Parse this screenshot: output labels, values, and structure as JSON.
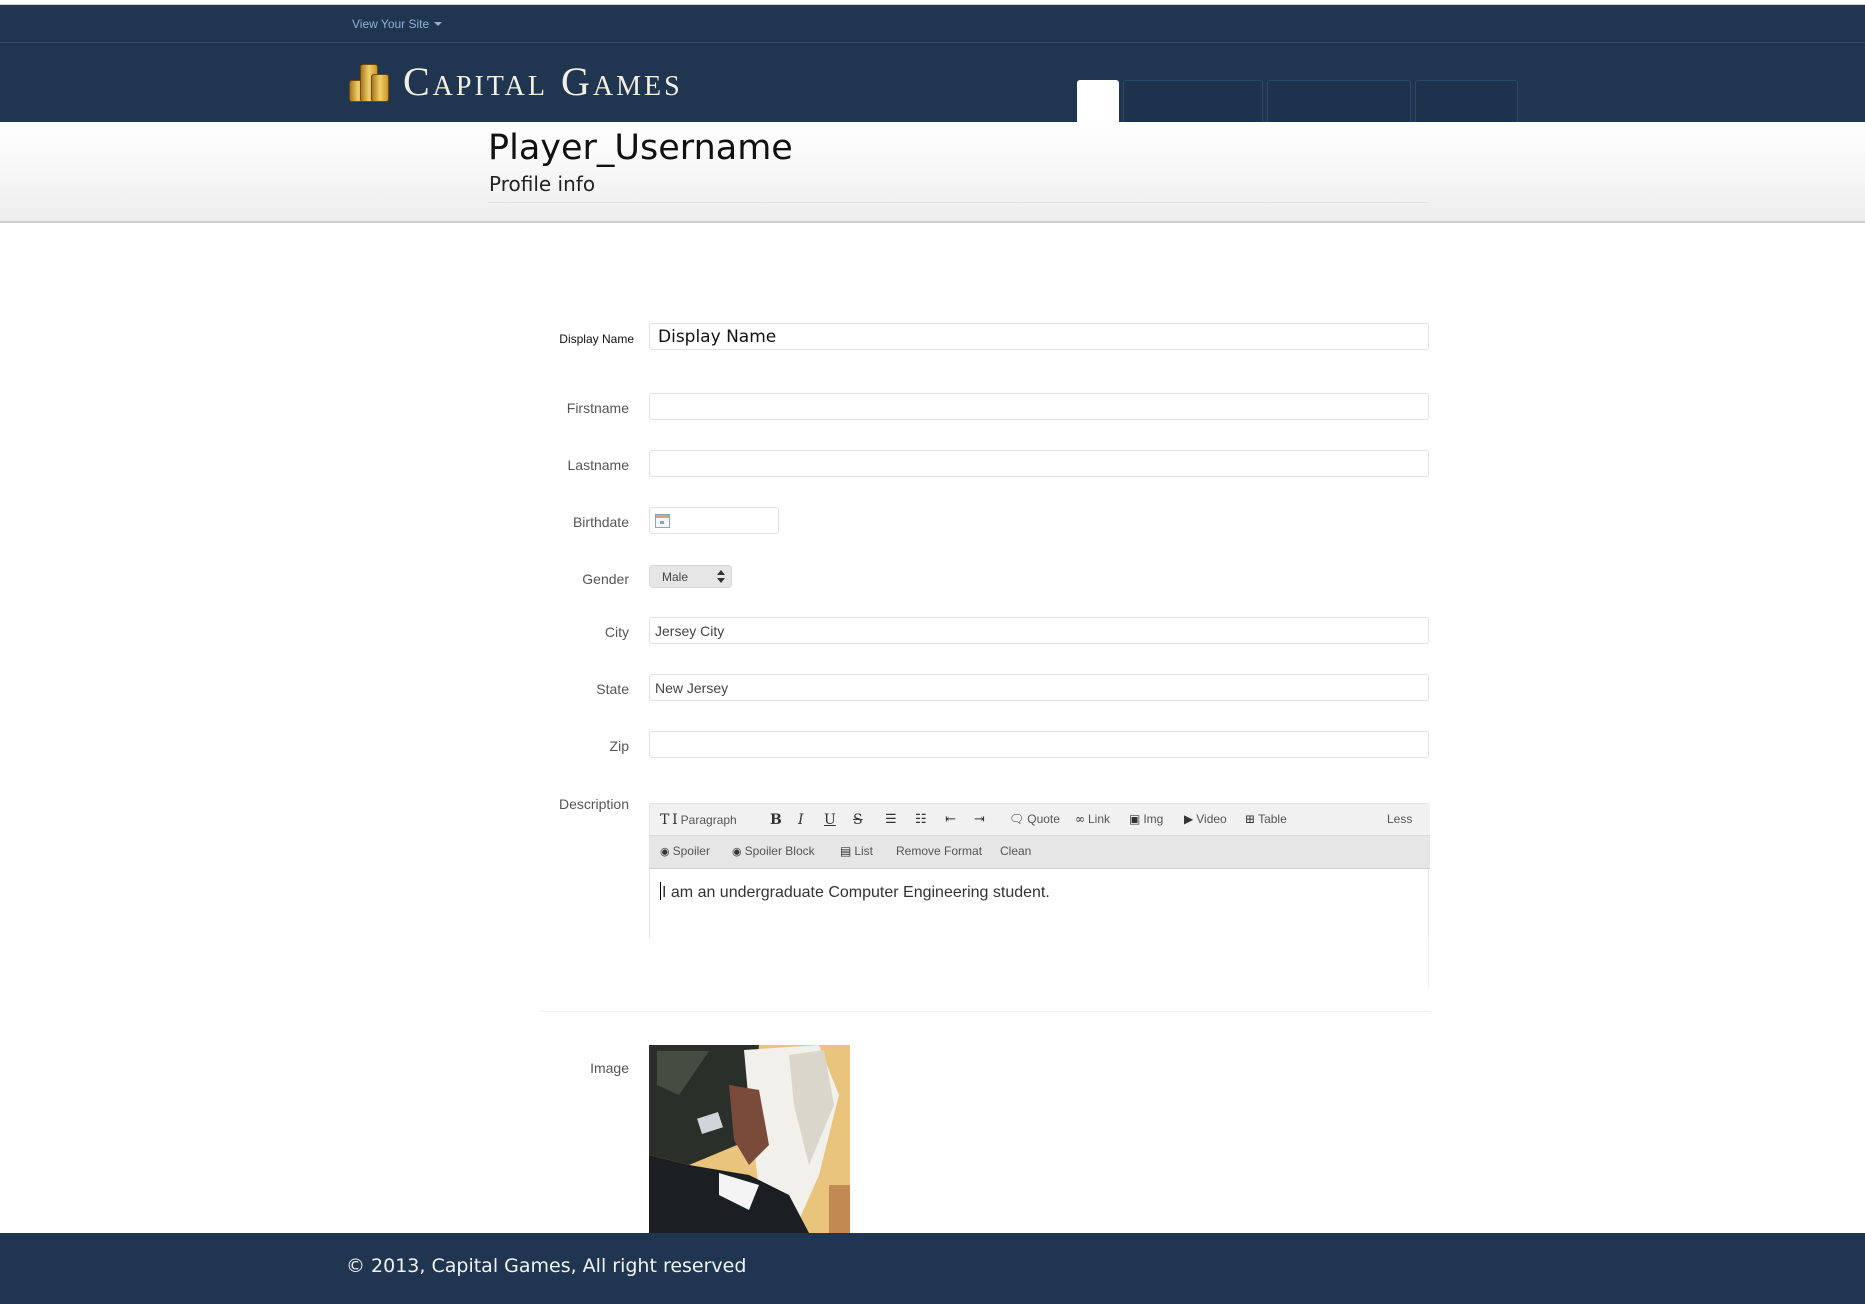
{
  "topbar": {
    "view_site_label": "View Your Site"
  },
  "header": {
    "logo_text": "Capital Games"
  },
  "page": {
    "title": "Player_Username",
    "subtitle": "Profile info"
  },
  "form": {
    "display_name": {
      "label": "Display Name",
      "value": "Display Name"
    },
    "firstname": {
      "label": "Firstname",
      "value": ""
    },
    "lastname": {
      "label": "Lastname",
      "value": ""
    },
    "birthdate": {
      "label": "Birthdate",
      "value": ""
    },
    "gender": {
      "label": "Gender",
      "selected": "Male"
    },
    "city": {
      "label": "City",
      "value": "Jersey City"
    },
    "state": {
      "label": "State",
      "value": "New Jersey"
    },
    "zip": {
      "label": "Zip",
      "value": ""
    },
    "description": {
      "label": "Description",
      "toolbar": {
        "paragraph": "Paragraph",
        "bold": "B",
        "italic": "I",
        "underline": "U",
        "strike": "S",
        "quote": "Quote",
        "link": "Link",
        "img": "Img",
        "video": "Video",
        "table": "Table",
        "less": "Less",
        "spoiler": "Spoiler",
        "spoiler_block": "Spoiler Block",
        "list": "List",
        "remove_format": "Remove Format",
        "clean": "Clean"
      },
      "content": "I am an undergraduate Computer Engineering student."
    },
    "image": {
      "label": "Image"
    }
  },
  "footer": {
    "copyright": "© 2013,  Capital Games, All right reserved"
  },
  "colors": {
    "navy": "#1f3550",
    "accent_link": "#8fb2d6"
  }
}
